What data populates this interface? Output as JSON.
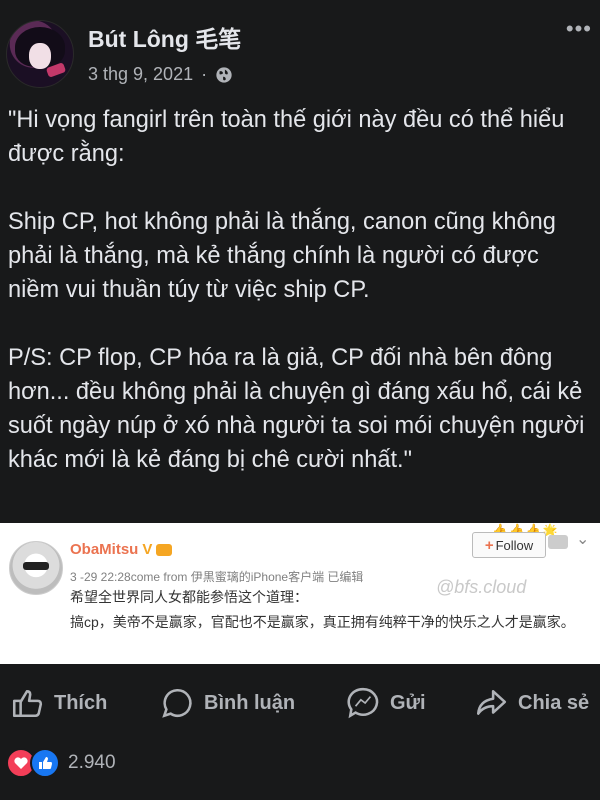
{
  "post": {
    "author": "Bút Lông 毛笔",
    "date": "3 thg 9, 2021",
    "separator": "·",
    "text": "\"Hi vọng fangirl trên toàn thế giới này đều có thể hiểu được rằng:\n\nShip CP, hot không phải là thắng, canon cũng không phải là thắng, mà kẻ thắng chính là người có được niềm vui thuần túy từ việc ship CP.\n\nP/S: CP flop, CP hóa ra là giả, CP đối nhà bên đông hơn... đều không phải là chuyện gì đáng xấu hổ, cái kẻ suốt ngày núp ở xó nhà người ta soi mói chuyện người khác mới là kẻ đáng bị chê cười nhất.\"",
    "more_icon": "more-dots-icon",
    "privacy_icon": "globe-icon"
  },
  "embed": {
    "username": "ObaMitsu",
    "verified": "V",
    "follow_label": "Follow",
    "meta": "3 -29 22:28come from 伊黒蜜璃的iPhone客户端  已编辑",
    "watermark": "@bfs.cloud",
    "line1": "希望全世界同人女都能参悟这个道理：",
    "line2": "搞cp，美帝不是赢家，官配也不是赢家，真正拥有纯粹干净的快乐之人才是赢家。"
  },
  "actions": {
    "like": "Thích",
    "comment": "Bình luận",
    "send": "Gửi",
    "share": "Chia sẻ"
  },
  "reactions": {
    "count": "2.940",
    "types": [
      "love-icon",
      "like-icon"
    ]
  },
  "colors": {
    "background": "#18191a",
    "text": "#e4e6eb",
    "muted": "#b0b3b8",
    "weibo_orange": "#eb7350",
    "love": "#f33e58",
    "like": "#1877f2"
  }
}
